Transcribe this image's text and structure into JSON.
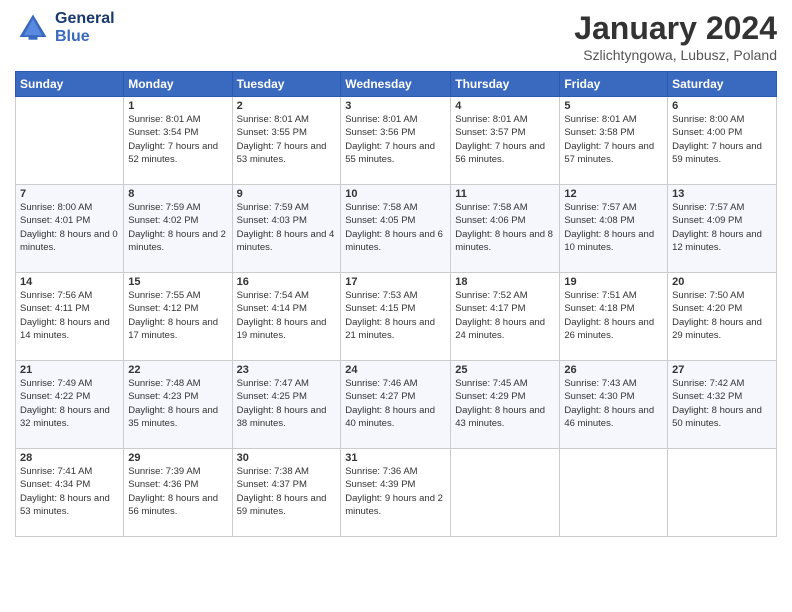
{
  "header": {
    "logo_line1": "General",
    "logo_line2": "Blue",
    "month_title": "January 2024",
    "location": "Szlichtyngowa, Lubusz, Poland"
  },
  "weekdays": [
    "Sunday",
    "Monday",
    "Tuesday",
    "Wednesday",
    "Thursday",
    "Friday",
    "Saturday"
  ],
  "weeks": [
    [
      {
        "day": "",
        "sunrise": "",
        "sunset": "",
        "daylight": ""
      },
      {
        "day": "1",
        "sunrise": "Sunrise: 8:01 AM",
        "sunset": "Sunset: 3:54 PM",
        "daylight": "Daylight: 7 hours and 52 minutes."
      },
      {
        "day": "2",
        "sunrise": "Sunrise: 8:01 AM",
        "sunset": "Sunset: 3:55 PM",
        "daylight": "Daylight: 7 hours and 53 minutes."
      },
      {
        "day": "3",
        "sunrise": "Sunrise: 8:01 AM",
        "sunset": "Sunset: 3:56 PM",
        "daylight": "Daylight: 7 hours and 55 minutes."
      },
      {
        "day": "4",
        "sunrise": "Sunrise: 8:01 AM",
        "sunset": "Sunset: 3:57 PM",
        "daylight": "Daylight: 7 hours and 56 minutes."
      },
      {
        "day": "5",
        "sunrise": "Sunrise: 8:01 AM",
        "sunset": "Sunset: 3:58 PM",
        "daylight": "Daylight: 7 hours and 57 minutes."
      },
      {
        "day": "6",
        "sunrise": "Sunrise: 8:00 AM",
        "sunset": "Sunset: 4:00 PM",
        "daylight": "Daylight: 7 hours and 59 minutes."
      }
    ],
    [
      {
        "day": "7",
        "sunrise": "Sunrise: 8:00 AM",
        "sunset": "Sunset: 4:01 PM",
        "daylight": "Daylight: 8 hours and 0 minutes."
      },
      {
        "day": "8",
        "sunrise": "Sunrise: 7:59 AM",
        "sunset": "Sunset: 4:02 PM",
        "daylight": "Daylight: 8 hours and 2 minutes."
      },
      {
        "day": "9",
        "sunrise": "Sunrise: 7:59 AM",
        "sunset": "Sunset: 4:03 PM",
        "daylight": "Daylight: 8 hours and 4 minutes."
      },
      {
        "day": "10",
        "sunrise": "Sunrise: 7:58 AM",
        "sunset": "Sunset: 4:05 PM",
        "daylight": "Daylight: 8 hours and 6 minutes."
      },
      {
        "day": "11",
        "sunrise": "Sunrise: 7:58 AM",
        "sunset": "Sunset: 4:06 PM",
        "daylight": "Daylight: 8 hours and 8 minutes."
      },
      {
        "day": "12",
        "sunrise": "Sunrise: 7:57 AM",
        "sunset": "Sunset: 4:08 PM",
        "daylight": "Daylight: 8 hours and 10 minutes."
      },
      {
        "day": "13",
        "sunrise": "Sunrise: 7:57 AM",
        "sunset": "Sunset: 4:09 PM",
        "daylight": "Daylight: 8 hours and 12 minutes."
      }
    ],
    [
      {
        "day": "14",
        "sunrise": "Sunrise: 7:56 AM",
        "sunset": "Sunset: 4:11 PM",
        "daylight": "Daylight: 8 hours and 14 minutes."
      },
      {
        "day": "15",
        "sunrise": "Sunrise: 7:55 AM",
        "sunset": "Sunset: 4:12 PM",
        "daylight": "Daylight: 8 hours and 17 minutes."
      },
      {
        "day": "16",
        "sunrise": "Sunrise: 7:54 AM",
        "sunset": "Sunset: 4:14 PM",
        "daylight": "Daylight: 8 hours and 19 minutes."
      },
      {
        "day": "17",
        "sunrise": "Sunrise: 7:53 AM",
        "sunset": "Sunset: 4:15 PM",
        "daylight": "Daylight: 8 hours and 21 minutes."
      },
      {
        "day": "18",
        "sunrise": "Sunrise: 7:52 AM",
        "sunset": "Sunset: 4:17 PM",
        "daylight": "Daylight: 8 hours and 24 minutes."
      },
      {
        "day": "19",
        "sunrise": "Sunrise: 7:51 AM",
        "sunset": "Sunset: 4:18 PM",
        "daylight": "Daylight: 8 hours and 26 minutes."
      },
      {
        "day": "20",
        "sunrise": "Sunrise: 7:50 AM",
        "sunset": "Sunset: 4:20 PM",
        "daylight": "Daylight: 8 hours and 29 minutes."
      }
    ],
    [
      {
        "day": "21",
        "sunrise": "Sunrise: 7:49 AM",
        "sunset": "Sunset: 4:22 PM",
        "daylight": "Daylight: 8 hours and 32 minutes."
      },
      {
        "day": "22",
        "sunrise": "Sunrise: 7:48 AM",
        "sunset": "Sunset: 4:23 PM",
        "daylight": "Daylight: 8 hours and 35 minutes."
      },
      {
        "day": "23",
        "sunrise": "Sunrise: 7:47 AM",
        "sunset": "Sunset: 4:25 PM",
        "daylight": "Daylight: 8 hours and 38 minutes."
      },
      {
        "day": "24",
        "sunrise": "Sunrise: 7:46 AM",
        "sunset": "Sunset: 4:27 PM",
        "daylight": "Daylight: 8 hours and 40 minutes."
      },
      {
        "day": "25",
        "sunrise": "Sunrise: 7:45 AM",
        "sunset": "Sunset: 4:29 PM",
        "daylight": "Daylight: 8 hours and 43 minutes."
      },
      {
        "day": "26",
        "sunrise": "Sunrise: 7:43 AM",
        "sunset": "Sunset: 4:30 PM",
        "daylight": "Daylight: 8 hours and 46 minutes."
      },
      {
        "day": "27",
        "sunrise": "Sunrise: 7:42 AM",
        "sunset": "Sunset: 4:32 PM",
        "daylight": "Daylight: 8 hours and 50 minutes."
      }
    ],
    [
      {
        "day": "28",
        "sunrise": "Sunrise: 7:41 AM",
        "sunset": "Sunset: 4:34 PM",
        "daylight": "Daylight: 8 hours and 53 minutes."
      },
      {
        "day": "29",
        "sunrise": "Sunrise: 7:39 AM",
        "sunset": "Sunset: 4:36 PM",
        "daylight": "Daylight: 8 hours and 56 minutes."
      },
      {
        "day": "30",
        "sunrise": "Sunrise: 7:38 AM",
        "sunset": "Sunset: 4:37 PM",
        "daylight": "Daylight: 8 hours and 59 minutes."
      },
      {
        "day": "31",
        "sunrise": "Sunrise: 7:36 AM",
        "sunset": "Sunset: 4:39 PM",
        "daylight": "Daylight: 9 hours and 2 minutes."
      },
      {
        "day": "",
        "sunrise": "",
        "sunset": "",
        "daylight": ""
      },
      {
        "day": "",
        "sunrise": "",
        "sunset": "",
        "daylight": ""
      },
      {
        "day": "",
        "sunrise": "",
        "sunset": "",
        "daylight": ""
      }
    ]
  ]
}
